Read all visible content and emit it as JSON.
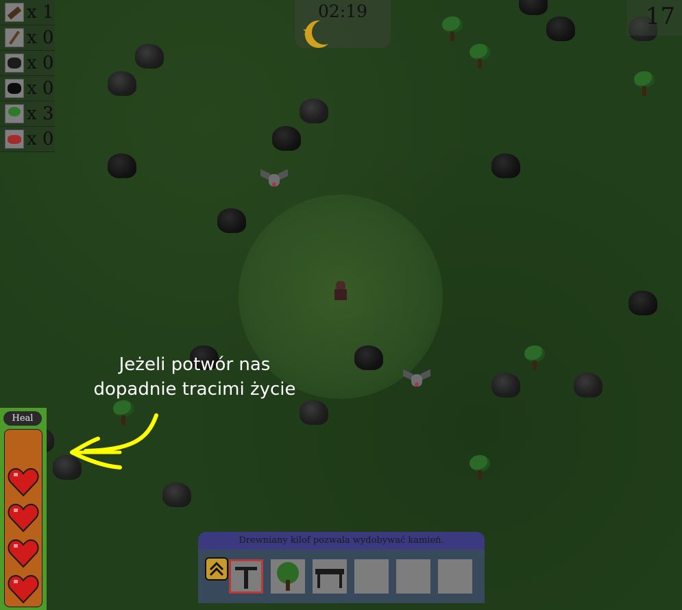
{
  "resources": [
    {
      "icon": "log-icon",
      "count": "x 1"
    },
    {
      "icon": "stick-icon",
      "count": "x 0"
    },
    {
      "icon": "stone-icon",
      "count": "x 0"
    },
    {
      "icon": "coal-icon",
      "count": "x 0"
    },
    {
      "icon": "sapling-icon",
      "count": "x 3"
    },
    {
      "icon": "meat-icon",
      "count": "x 0"
    }
  ],
  "timer": {
    "time": "02:19",
    "phase_icon": "moon-icon"
  },
  "score": "17",
  "annotation": {
    "line1": "Jeżeli potwór nas",
    "line2": "dopadnie tracimi życie"
  },
  "health": {
    "heal_label": "Heal",
    "hearts": 4
  },
  "toolbar": {
    "description": "Drewniany kilof pozwala wydobywać kamień.",
    "slots": [
      "pickaxe-icon",
      "tree-icon",
      "workbench-icon",
      "",
      "",
      ""
    ],
    "selected_slot": 0
  },
  "colors": {
    "grass": "#213f1a",
    "health_panel": "#4d9b2a",
    "hearts_bg": "#b8611a",
    "toolbar": "#37495a",
    "toolbar_header": "#3b3a80",
    "annotation_arrow": "#ffff00"
  }
}
